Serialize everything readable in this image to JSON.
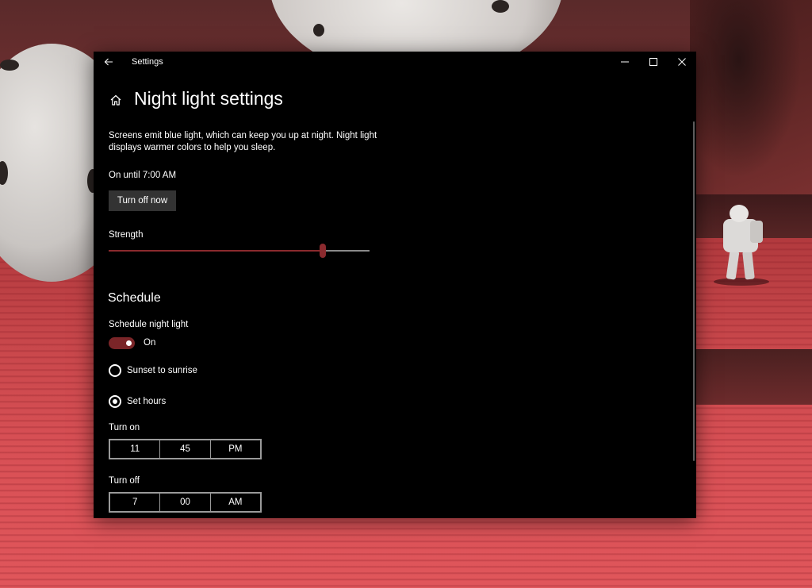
{
  "window": {
    "title": "Settings"
  },
  "page": {
    "title": "Night light settings",
    "description": "Screens emit blue light, which can keep you up at night. Night light displays warmer colors to help you sleep.",
    "status": "On until 7:00 AM",
    "turn_off_button": "Turn off now",
    "strength_label": "Strength",
    "strength_percent": 82
  },
  "schedule": {
    "heading": "Schedule",
    "toggle_label": "Schedule night light",
    "toggle_state": "On",
    "options": [
      {
        "label": "Sunset to sunrise",
        "selected": false
      },
      {
        "label": "Set hours",
        "selected": true
      }
    ],
    "turn_on": {
      "label": "Turn on",
      "hour": "11",
      "minute": "45",
      "period": "PM"
    },
    "turn_off": {
      "label": "Turn off",
      "hour": "7",
      "minute": "00",
      "period": "AM"
    }
  },
  "icons": {
    "back": "arrow-left-icon",
    "home": "home-icon",
    "minimize": "minimize-icon",
    "maximize": "maximize-icon",
    "close": "close-icon"
  },
  "colors": {
    "accent": "#8b2a2e",
    "window_bg": "#000000",
    "button_bg": "#333333"
  }
}
